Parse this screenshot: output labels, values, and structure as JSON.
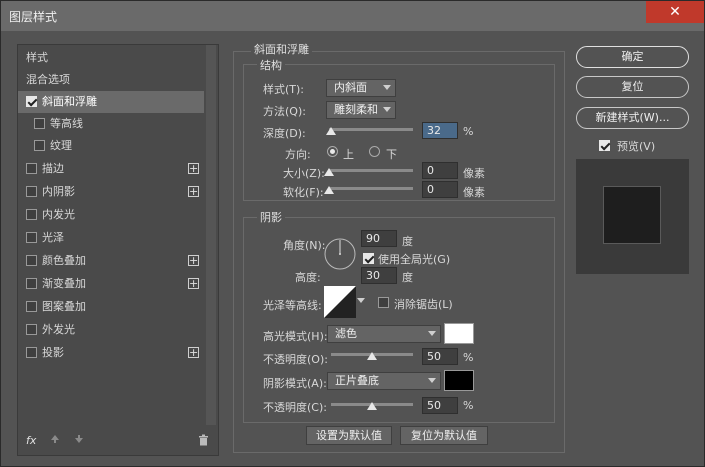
{
  "window": {
    "title": "图层样式",
    "close_label": "✕"
  },
  "left": {
    "items": [
      {
        "label": "样式"
      },
      {
        "label": "混合选项"
      },
      {
        "label": "斜面和浮雕"
      },
      {
        "label": "等高线"
      },
      {
        "label": "纹理"
      },
      {
        "label": "描边"
      },
      {
        "label": "内阴影"
      },
      {
        "label": "内发光"
      },
      {
        "label": "光泽"
      },
      {
        "label": "颜色叠加"
      },
      {
        "label": "渐变叠加"
      },
      {
        "label": "图案叠加"
      },
      {
        "label": "外发光"
      },
      {
        "label": "投影"
      }
    ],
    "fx_label": "fx"
  },
  "bevel": {
    "section_title": "斜面和浮雕",
    "structure_title": "结构",
    "style_label": "样式(T):",
    "style_value": "内斜面",
    "method_label": "方法(Q):",
    "method_value": "雕刻柔和",
    "depth_label": "深度(D):",
    "depth_value": "32",
    "depth_unit": "%",
    "direction_label": "方向:",
    "dir_up": "上",
    "dir_down": "下",
    "size_label": "大小(Z):",
    "size_value": "0",
    "size_unit": "像素",
    "soften_label": "软化(F):",
    "soften_value": "0",
    "soften_unit": "像素"
  },
  "shading": {
    "title": "阴影",
    "angle_label": "角度(N):",
    "angle_value": "90",
    "angle_unit": "度",
    "global_light_label": "使用全局光(G)",
    "altitude_label": "高度:",
    "altitude_value": "30",
    "altitude_unit": "度",
    "gloss_label": "光泽等高线:",
    "antialias_label": "消除锯齿(L)",
    "highlight_label": "高光模式(H):",
    "highlight_value": "滤色",
    "highlight_color": "#ffffff",
    "hl_opacity_label": "不透明度(O):",
    "hl_opacity_value": "50",
    "shadow_label": "阴影模式(A):",
    "shadow_value": "正片叠底",
    "shadow_color": "#000000",
    "sh_opacity_label": "不透明度(C):",
    "sh_opacity_value": "50",
    "percent": "%"
  },
  "buttons": {
    "make_default": "设置为默认值",
    "reset_default": "复位为默认值",
    "ok": "确定",
    "reset": "复位",
    "new_style": "新建样式(W)...",
    "preview": "预览(V)"
  }
}
